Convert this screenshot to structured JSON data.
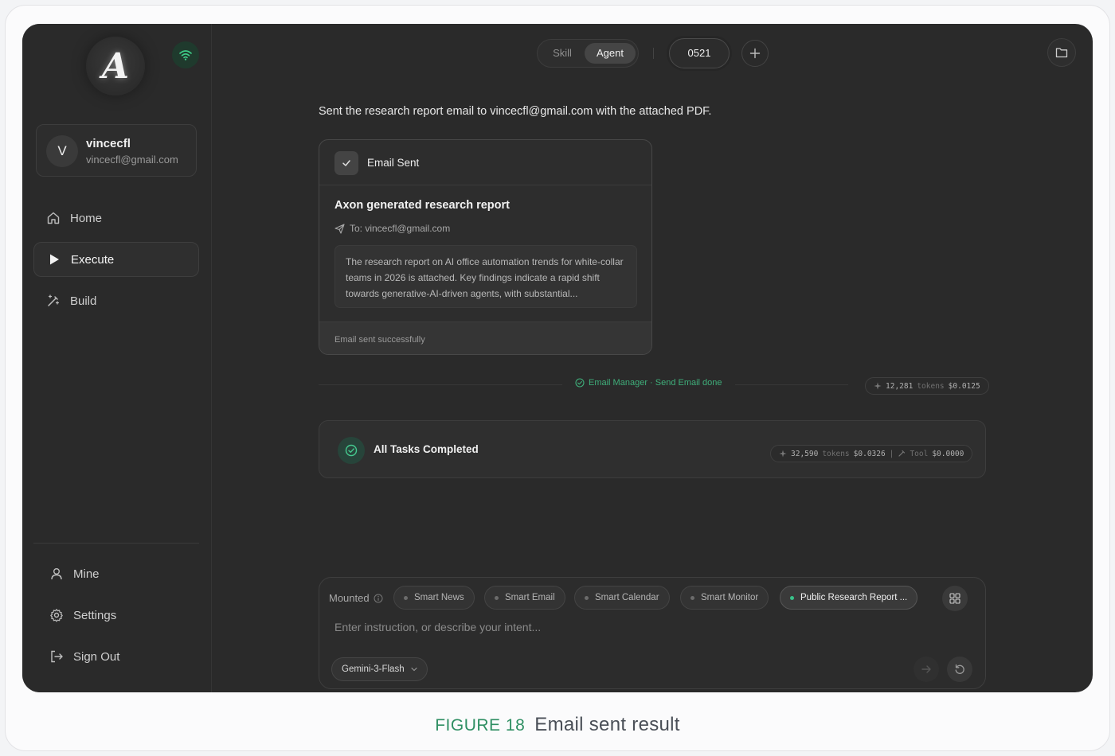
{
  "app": {
    "logo_letter": "A",
    "user": {
      "initial": "V",
      "name": "vincecfl",
      "email": "vincecfl@gmail.com"
    },
    "nav": [
      {
        "label": "Home",
        "icon": "home-icon",
        "active": false
      },
      {
        "label": "Execute",
        "icon": "play-icon",
        "active": true
      },
      {
        "label": "Build",
        "icon": "magic-wand-icon",
        "active": false
      }
    ],
    "bottom_nav": [
      {
        "label": "Mine",
        "icon": "user-icon"
      },
      {
        "label": "Settings",
        "icon": "gear-icon"
      },
      {
        "label": "Sign Out",
        "icon": "sign-out-icon"
      }
    ]
  },
  "topbar": {
    "mode_skill": "Skill",
    "mode_agent": "Agent",
    "active_mode": "Agent",
    "session": "0521"
  },
  "chat": {
    "message": "Sent the research report email to vincecfl@gmail.com with the attached PDF.",
    "email_card": {
      "header": "Email Sent",
      "title": "Axon generated research report",
      "to": "To: vincecfl@gmail.com",
      "body": "The research report on AI office automation trends for white-collar teams in 2026 is attached. Key findings indicate a rapid shift towards generative-AI-driven agents, with substantial...",
      "footer": "Email sent successfully"
    },
    "step_status": "Email Manager · Send Email done",
    "step_tokens": {
      "count": "12,281",
      "unit": "tokens",
      "cost": "$0.0125"
    },
    "tasks": {
      "label": "All Tasks Completed",
      "tokens": {
        "count": "32,590",
        "unit": "tokens",
        "cost": "$0.0326"
      },
      "tool": {
        "label": "Tool",
        "cost": "$0.0000"
      }
    }
  },
  "composer": {
    "mounted_label": "Mounted",
    "chips": [
      "Smart News",
      "Smart Email",
      "Smart Calendar",
      "Smart Monitor",
      "Public Research Report ..."
    ],
    "active_chip": "Public Research Report ...",
    "placeholder": "Enter instruction, or describe your intent...",
    "model": "Gemini-3-Flash"
  },
  "caption": {
    "figure": "FIGURE 18",
    "text": "Email sent result"
  },
  "colors": {
    "accent_green": "#3fae7a",
    "background": "#2a2a2a"
  }
}
